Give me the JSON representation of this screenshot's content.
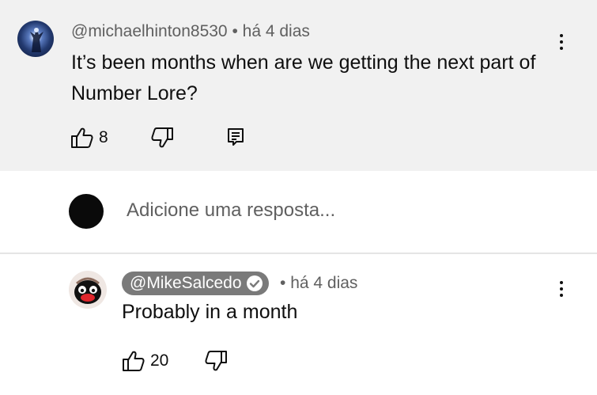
{
  "comment": {
    "author": "@michaelhinton8530",
    "separator": "•",
    "time": "há 4 dias",
    "text": "It’s been months when are we getting the next part of Number Lore?",
    "likes": "8",
    "icons": [
      "like-icon",
      "dislike-icon",
      "reply-icon",
      "more-vert-icon"
    ]
  },
  "reply_box": {
    "placeholder": "Adicione uma resposta..."
  },
  "reply": {
    "author": "@MikeSalcedo",
    "verified": true,
    "separator": "•",
    "time": "há 4 dias",
    "text": "Probably in a month",
    "likes": "20",
    "icons": [
      "like-icon",
      "dislike-icon",
      "more-vert-icon"
    ]
  },
  "colors": {
    "comment_background": "#f1f1f1",
    "meta_text": "#606060",
    "author_chip": "#7a7a7a"
  }
}
